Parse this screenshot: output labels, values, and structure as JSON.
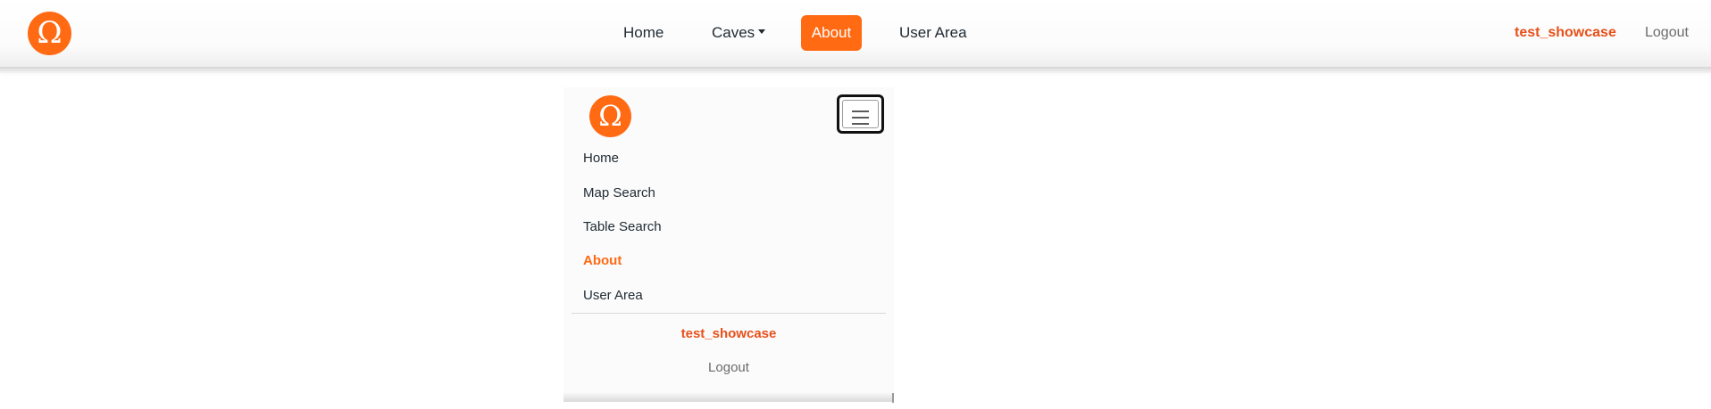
{
  "brand": {
    "logo_glyph": "Ω",
    "logo_color": "#ff6a13"
  },
  "top_nav": {
    "items": [
      {
        "label": "Home"
      },
      {
        "label": "Caves",
        "has_dropdown": true
      },
      {
        "label": "About",
        "active": true
      },
      {
        "label": "User Area"
      }
    ],
    "username": "test_showcase",
    "logout": "Logout",
    "active_color": "#ff6a13",
    "username_color": "#e8501a"
  },
  "mobile_menu": {
    "toggle_icon": "hamburger-icon",
    "items": [
      {
        "label": "Home"
      },
      {
        "label": "Map Search"
      },
      {
        "label": "Table Search"
      },
      {
        "label": "About",
        "active": true
      },
      {
        "label": "User Area"
      }
    ],
    "username": "test_showcase",
    "logout": "Logout"
  }
}
